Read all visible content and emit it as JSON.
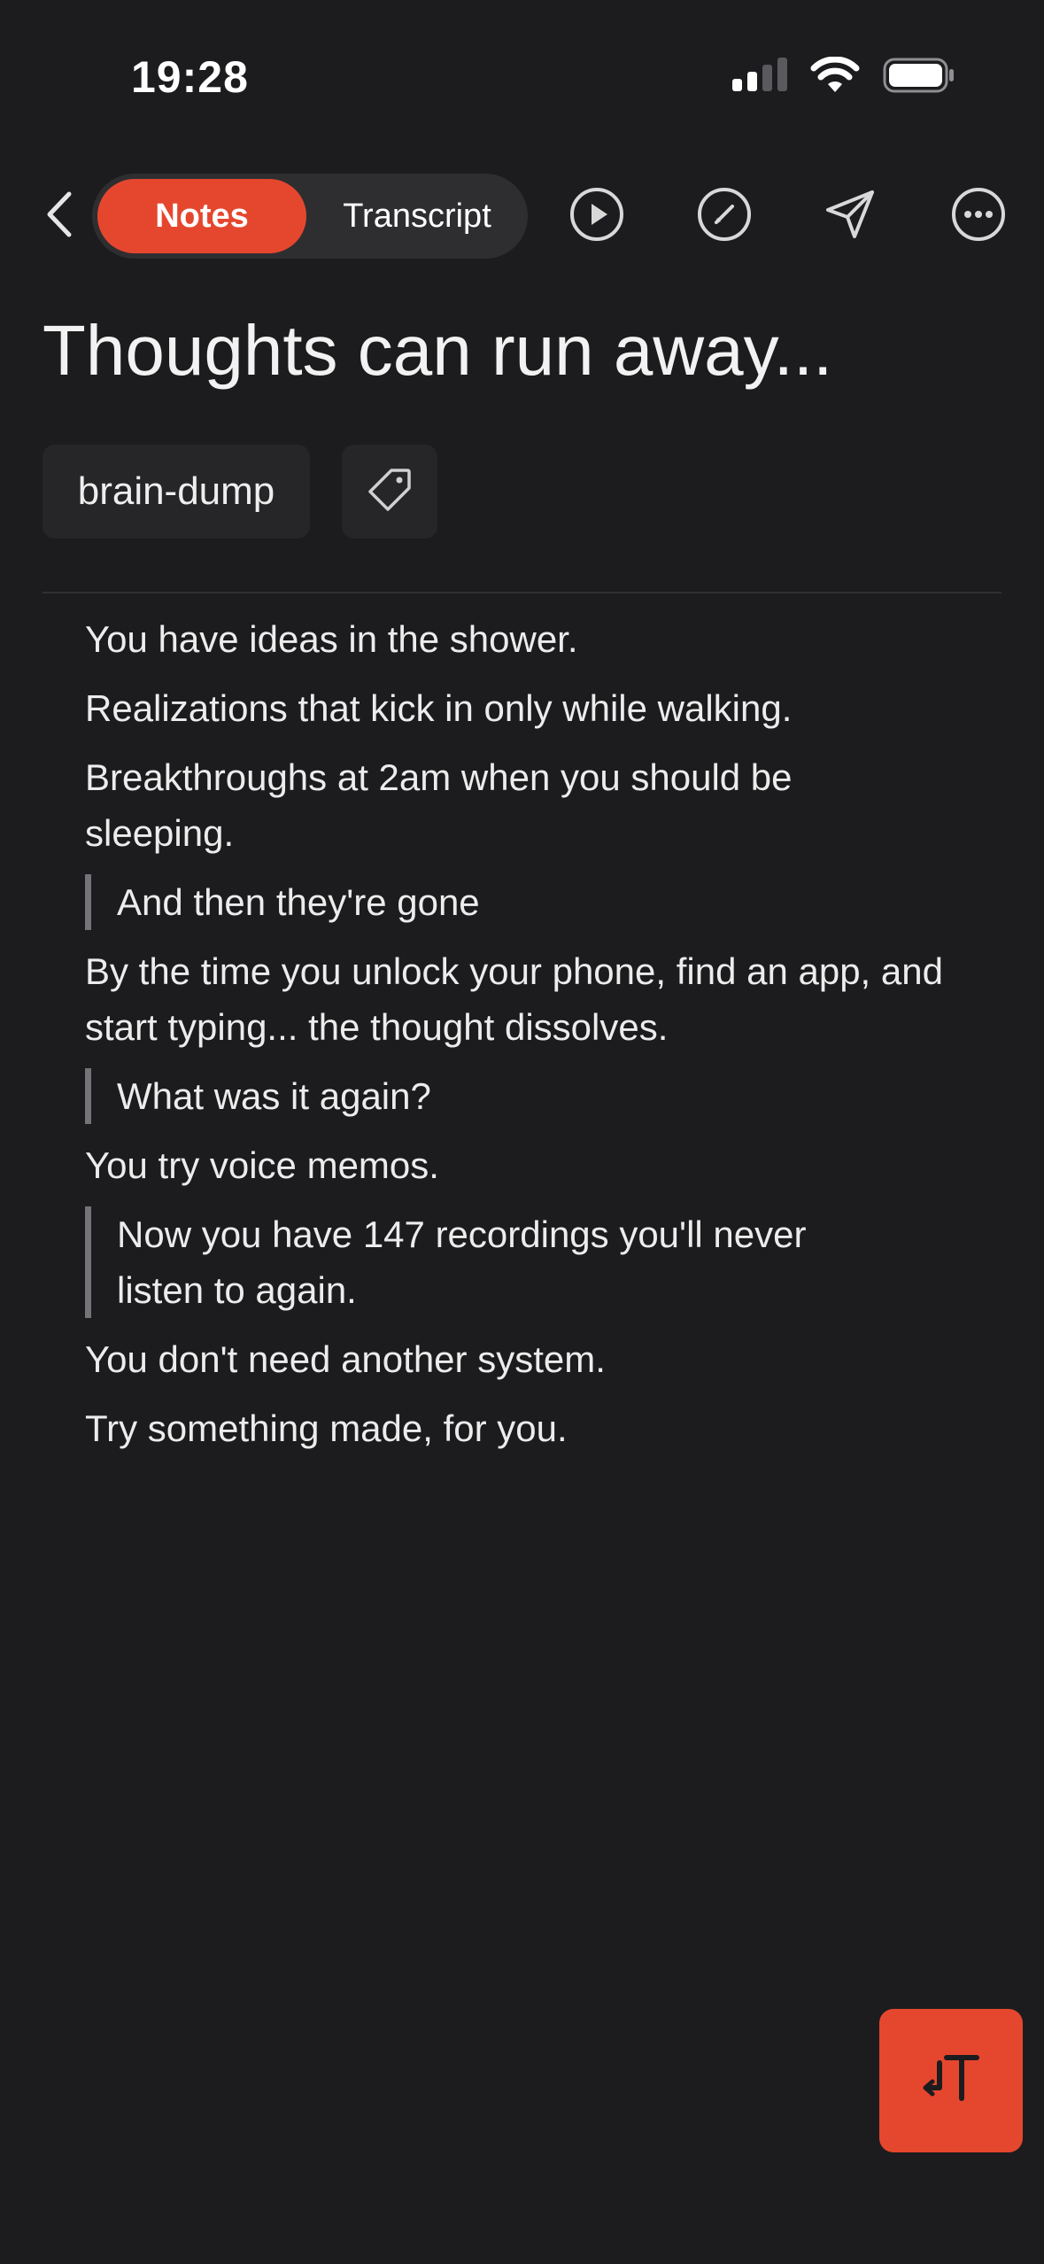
{
  "status_bar": {
    "time": "19:28"
  },
  "toolbar": {
    "tabs": [
      {
        "label": "Notes",
        "selected": true
      },
      {
        "label": "Transcript",
        "selected": false
      }
    ],
    "icons": [
      "chevron-left-icon",
      "play-icon",
      "edit-icon",
      "send-icon",
      "more-icon"
    ]
  },
  "note": {
    "title": "Thoughts can run away...",
    "tags": [
      "brain-dump"
    ],
    "blocks": [
      {
        "type": "p",
        "text": "You have ideas in the shower."
      },
      {
        "type": "p",
        "text": "Realizations that kick in only while walking."
      },
      {
        "type": "p",
        "text": "Breakthroughs at 2am when you should be sleeping."
      },
      {
        "type": "quote",
        "text": "And then they're gone"
      },
      {
        "type": "p",
        "text": "By the time you unlock your phone, find an app, and start typing... the thought dissolves."
      },
      {
        "type": "quote",
        "text": "What was it again?"
      },
      {
        "type": "p",
        "text": "You try voice memos."
      },
      {
        "type": "quote",
        "text": "Now you have 147 recordings you'll never listen to again."
      },
      {
        "type": "p",
        "text": "You don't need another system."
      },
      {
        "type": "p",
        "text": "Try something made, for you."
      }
    ]
  },
  "fab": {
    "icon": "text-format-icon"
  },
  "colors": {
    "background": "#1c1c1e",
    "accent": "#e5472e",
    "text": "#ececec"
  }
}
